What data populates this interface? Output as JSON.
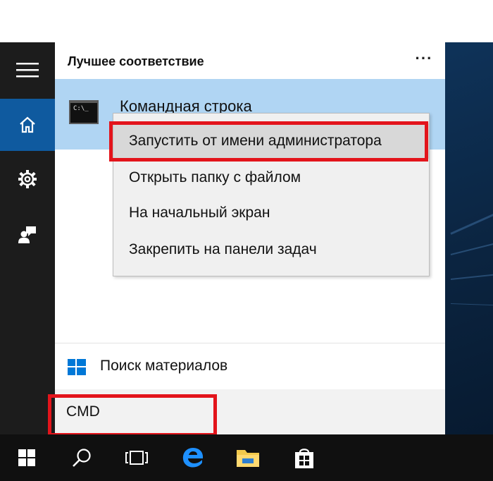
{
  "start_panel": {
    "section_title": "Лучшее соответствие",
    "more_label": "···",
    "best_match": {
      "title": "Командная строка",
      "icon": "command-prompt-icon",
      "icon_text": "C:\\_"
    },
    "search_web_label": "Поиск материалов",
    "search_query": "CMD"
  },
  "context_menu": {
    "items": [
      {
        "label": "Запустить от имени администратора",
        "highlighted": true
      },
      {
        "label": "Открыть папку с файлом"
      },
      {
        "label": "На начальный экран"
      },
      {
        "label": "Закрепить на панели задач"
      }
    ]
  },
  "left_rail": {
    "items": [
      "hamburger-menu-icon",
      "home-icon",
      "settings-gear-icon",
      "feedback-icon"
    ],
    "active": "home-icon"
  },
  "taskbar": {
    "items": [
      "windows-start-icon",
      "search-icon",
      "task-view-icon",
      "edge-icon",
      "file-explorer-icon",
      "store-icon"
    ]
  },
  "colors": {
    "accent": "#0f5a9f",
    "best_match_bg": "#b0d5f3",
    "highlight_red": "#e3141b",
    "taskbar": "#101010",
    "rail": "#1c1c1c"
  }
}
